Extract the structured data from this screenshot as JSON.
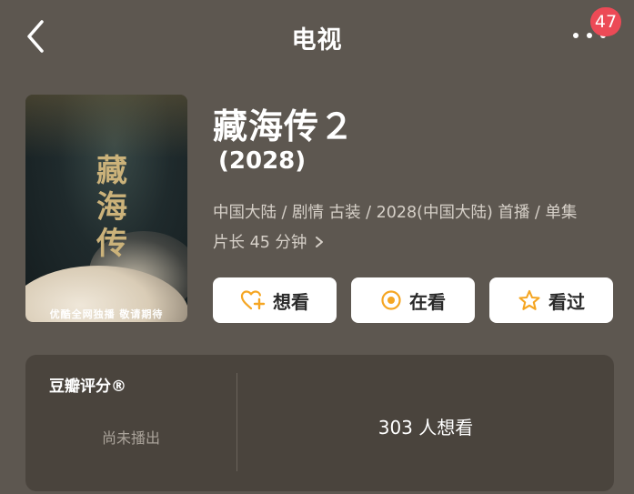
{
  "header": {
    "title": "电视",
    "badge_count": "47"
  },
  "poster": {
    "title_text": "藏海传",
    "caption": "优酷全网独播 敬请期待"
  },
  "show": {
    "title": "藏海传２",
    "year": "(2028)",
    "meta_line": "中国大陆 / 剧情 古装 / 2028(中国大陆) 首播 / 单集",
    "duration": "片长 45 分钟"
  },
  "actions": {
    "want_label": "想看",
    "watching_label": "在看",
    "watched_label": "看过",
    "accent_color": "#f5a623"
  },
  "rating": {
    "label": "豆瓣评分®",
    "status": "尚未播出",
    "want_count": "303 人想看"
  }
}
